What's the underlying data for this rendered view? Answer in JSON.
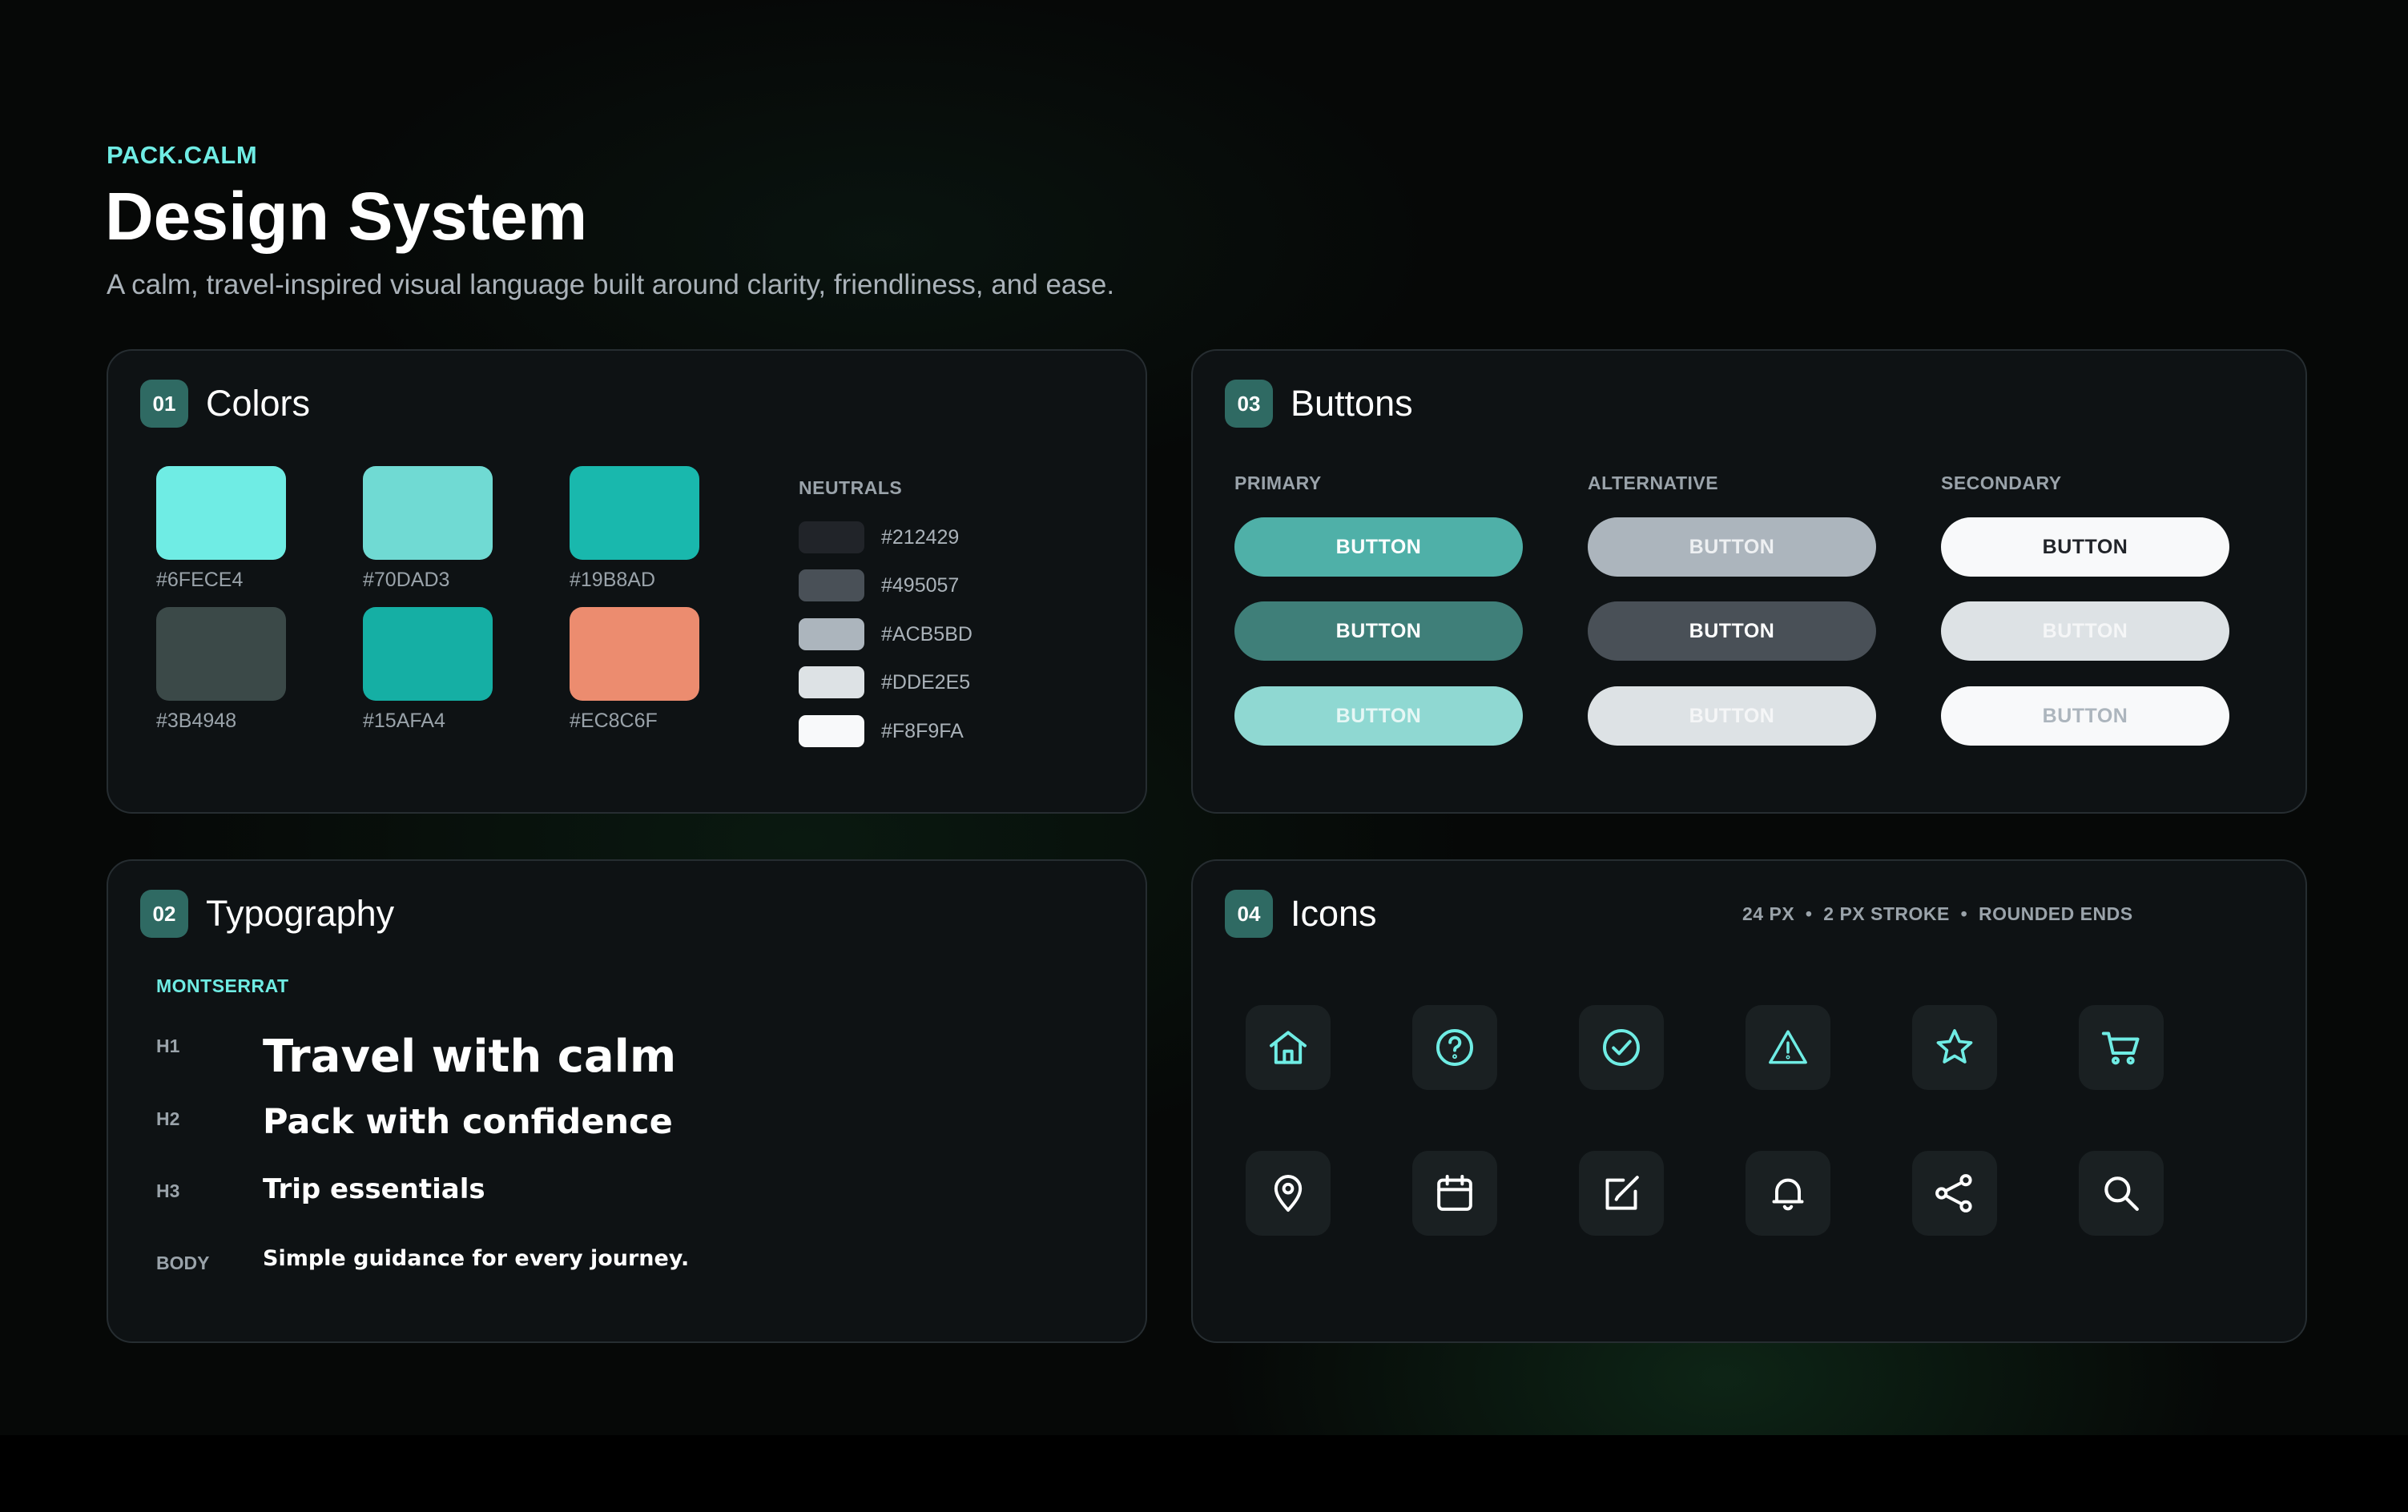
{
  "header": {
    "brand": "PACK.CALM",
    "title": "Design System",
    "subtitle": "A calm, travel-inspired visual language built around clarity, friendliness, and ease."
  },
  "colors_card": {
    "number": "01",
    "title": "Colors",
    "swatches": [
      {
        "label": "#6FECE4",
        "color": "#6FECE4"
      },
      {
        "label": "#70DAD3",
        "color": "#70DAD3"
      },
      {
        "label": "#19B8AD",
        "color": "#19B8AD"
      },
      {
        "label": "#3B4948",
        "color": "#3B4948"
      },
      {
        "label": "#15AFA4",
        "color": "#15AFA4"
      },
      {
        "label": "#EC8C6F",
        "color": "#EC8C6F"
      }
    ],
    "neutrals_label": "NEUTRALS",
    "neutrals": [
      {
        "label": "#212429",
        "color": "#212429"
      },
      {
        "label": "#495057",
        "color": "#495057"
      },
      {
        "label": "#ACB5BD",
        "color": "#ACB5BD"
      },
      {
        "label": "#DDE2E5",
        "color": "#DDE2E5"
      },
      {
        "label": "#F8F9FA",
        "color": "#F8F9FA"
      }
    ]
  },
  "buttons_card": {
    "number": "03",
    "title": "Buttons",
    "columns": [
      {
        "label": "PRIMARY",
        "buttons": [
          {
            "label": "BUTTON",
            "bg": "#4fb0a8",
            "fg": "#ffffff"
          },
          {
            "label": "BUTTON",
            "bg": "#3f7f79",
            "fg": "#ffffff"
          },
          {
            "label": "BUTTON",
            "bg": "#8fd8d2",
            "fg": "#e6f7f5"
          }
        ]
      },
      {
        "label": "ALTERNATIVE",
        "buttons": [
          {
            "label": "BUTTON",
            "bg": "#acb5bd",
            "fg": "#eef0f2"
          },
          {
            "label": "BUTTON",
            "bg": "#495057",
            "fg": "#ffffff"
          },
          {
            "label": "BUTTON",
            "bg": "#dde2e5",
            "fg": "#f5f6f7"
          }
        ]
      },
      {
        "label": "SECONDARY",
        "buttons": [
          {
            "label": "BUTTON",
            "bg": "#f8f9fa",
            "fg": "#212429"
          },
          {
            "label": "BUTTON",
            "bg": "#dde2e5",
            "fg": "#f5f6f7"
          },
          {
            "label": "BUTTON",
            "bg": "#f8f9fa",
            "fg": "#acb5bd"
          }
        ]
      }
    ]
  },
  "typography_card": {
    "number": "02",
    "title": "Typography",
    "font_label": "MONTSERRAT",
    "rows": [
      {
        "tag": "H1",
        "sample": "Travel with calm"
      },
      {
        "tag": "H2",
        "sample": "Pack with confidence"
      },
      {
        "tag": "H3",
        "sample": "Trip essentials"
      },
      {
        "tag": "BODY",
        "sample": "Simple guidance for every journey."
      }
    ]
  },
  "icons_card": {
    "number": "04",
    "title": "Icons",
    "spec": "24 PX  •  2 PX STROKE  •  ROUNDED ENDS",
    "icons": [
      "home-icon",
      "help-icon",
      "check-circle-icon",
      "warning-icon",
      "star-icon",
      "cart-icon",
      "location-pin-icon",
      "calendar-icon",
      "edit-icon",
      "bell-icon",
      "share-icon",
      "search-icon"
    ],
    "accent": "#6FECE4",
    "neutral_icon_color": "#ffffff"
  }
}
